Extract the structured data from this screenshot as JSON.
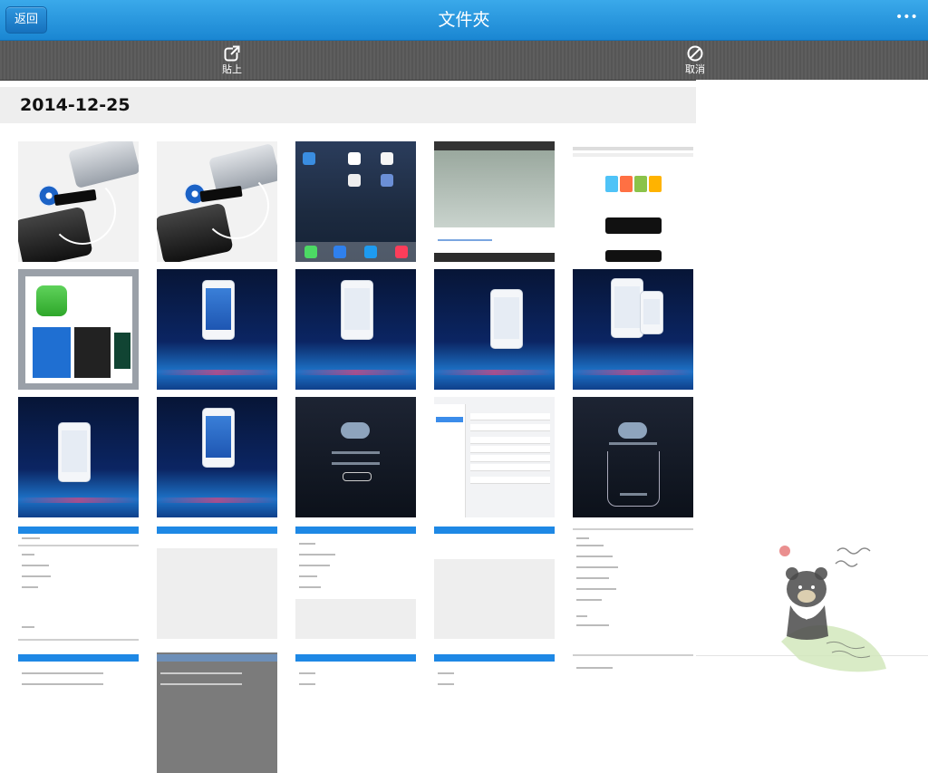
{
  "navbar": {
    "back_label": "返回",
    "title": "文件夾",
    "more_label": "•••"
  },
  "toolbar": {
    "paste_label": "貼上",
    "cancel_label": "取消"
  },
  "section": {
    "date": "2014-12-25"
  },
  "thumbnails": [
    {
      "name": "photo-hdd-1"
    },
    {
      "name": "photo-hdd-2"
    },
    {
      "name": "ipad-home"
    },
    {
      "name": "screenshot-camera"
    },
    {
      "name": "appstore-page"
    },
    {
      "name": "app-info"
    },
    {
      "name": "tutorial-1"
    },
    {
      "name": "tutorial-2"
    },
    {
      "name": "tutorial-3"
    },
    {
      "name": "tutorial-4"
    },
    {
      "name": "tutorial-5"
    },
    {
      "name": "tutorial-6"
    },
    {
      "name": "searching-device"
    },
    {
      "name": "settings-list"
    },
    {
      "name": "connect-screen"
    },
    {
      "name": "file-list-1"
    },
    {
      "name": "file-list-2"
    },
    {
      "name": "file-list-3"
    },
    {
      "name": "file-list-4"
    },
    {
      "name": "file-list-5"
    },
    {
      "name": "file-list-6"
    },
    {
      "name": "file-list-7"
    },
    {
      "name": "file-list-8"
    },
    {
      "name": "file-list-9"
    },
    {
      "name": "file-list-10"
    }
  ],
  "colors": {
    "navbar": "#1a86d2",
    "toolbar": "#5e5e5e",
    "date_bg": "#eeeeee"
  },
  "icons": {
    "paste": "share-arrow-icon",
    "cancel": "prohibit-icon",
    "more": "ellipsis-icon"
  }
}
